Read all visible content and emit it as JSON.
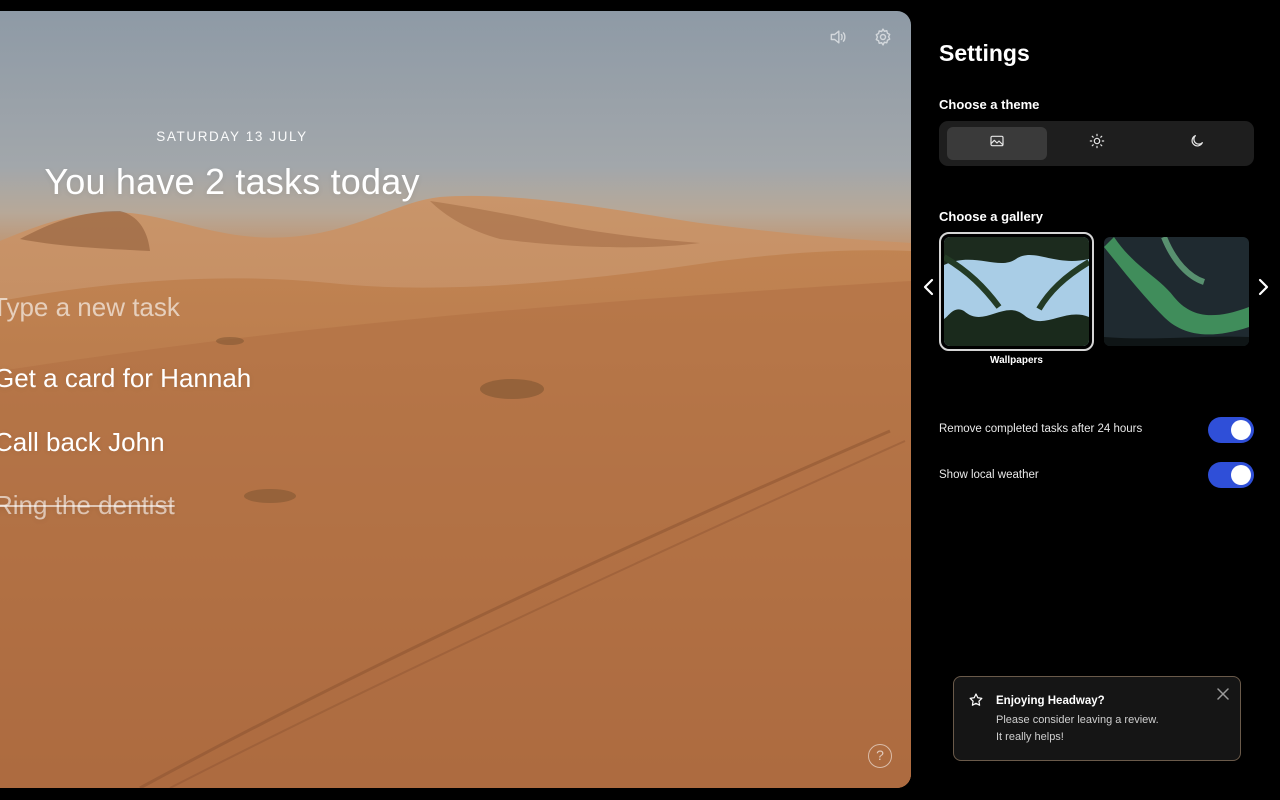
{
  "main": {
    "date": "SATURDAY 13 JULY",
    "headline": "You have 2 tasks today",
    "new_task_placeholder": "Type a new task",
    "tasks": [
      {
        "label": "Get a card for Hannah",
        "completed": false
      },
      {
        "label": "Call back John",
        "completed": false
      },
      {
        "label": "Ring the dentist",
        "completed": true
      }
    ],
    "help_glyph": "?",
    "icons": [
      "speaker-icon",
      "gear-icon",
      "help-icon"
    ]
  },
  "settings": {
    "title": "Settings",
    "theme_label": "Choose a theme",
    "themes": [
      {
        "icon": "image-icon",
        "active": true
      },
      {
        "icon": "sun-icon",
        "active": false
      },
      {
        "icon": "moon-icon",
        "active": false
      }
    ],
    "gallery_label": "Choose a gallery",
    "galleries": [
      {
        "caption": "Wallpapers",
        "selected": true
      },
      {
        "caption": "",
        "selected": false
      }
    ],
    "options": [
      {
        "label": "Remove completed tasks after 24 hours",
        "enabled": true
      },
      {
        "label": "Show local weather",
        "enabled": true
      }
    ],
    "accent_color": "#2f4fd8"
  },
  "toast": {
    "title": "Enjoying Headway?",
    "line1": "Please consider leaving a review.",
    "line2": "It really helps!"
  }
}
